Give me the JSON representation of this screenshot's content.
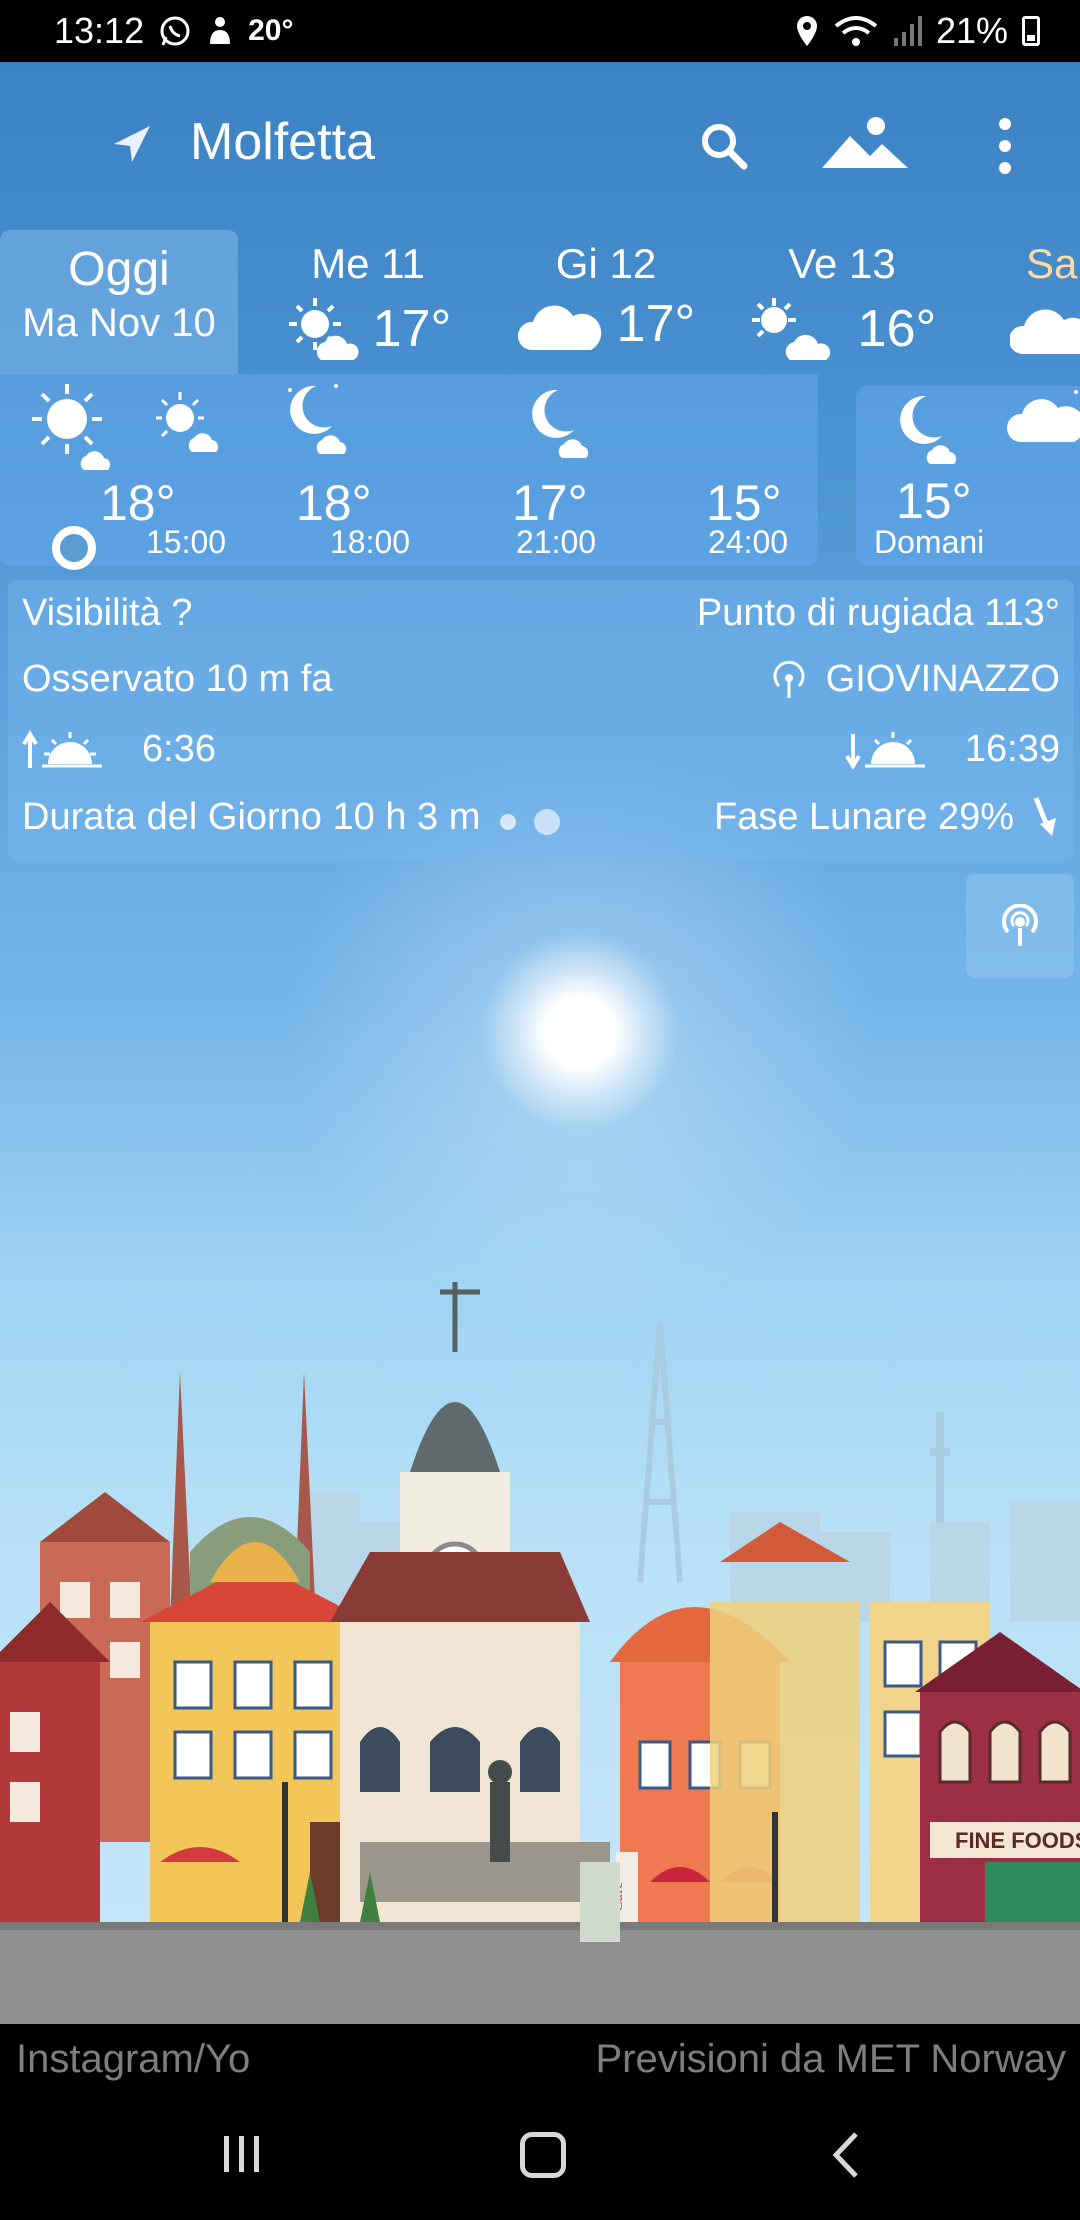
{
  "status_bar": {
    "time": "13:12",
    "temp_notification": "20°",
    "battery": "21%"
  },
  "header": {
    "city": "Molfetta"
  },
  "days": [
    {
      "name": "Oggi",
      "date": "Ma Nov 10"
    },
    {
      "name": "Me 11",
      "temp": "17°",
      "icon": "sun-cloud-icon"
    },
    {
      "name": "Gi 12",
      "temp": "17°",
      "icon": "cloud-icon"
    },
    {
      "name": "Ve 13",
      "temp": "16°",
      "icon": "sun-cloud-icon"
    },
    {
      "name": "Sa",
      "icon": "cloud-icon"
    }
  ],
  "hourly": [
    {
      "temp": "18°",
      "time": "15:00"
    },
    {
      "temp": "18°",
      "time": "18:00"
    },
    {
      "temp": "17°",
      "time": "21:00"
    },
    {
      "temp": "15°",
      "time": "24:00"
    }
  ],
  "tomorrow": {
    "temp": "15°",
    "label": "Domani"
  },
  "details": {
    "visibility": "Visibilità ?",
    "dew_point": "Punto di rugiada 113°",
    "observed": "Osservato 10 m fa",
    "station": "GIOVINAZZO",
    "sunrise": "6:36",
    "sunset": "16:39",
    "day_length": "Durata del Giorno 10 h 3 m",
    "moon_phase": "Fase Lunare 29%"
  },
  "city_sign": {
    "shop": "FINE FOODS",
    "cafe": "Cafe"
  },
  "footer": {
    "left": "Instagram/Yo",
    "right": "Previsioni da MET Norway"
  },
  "colors": {
    "sky_top": "#3b82c4",
    "panel": "#64aaeb",
    "accent_sun": "#ffffff"
  }
}
